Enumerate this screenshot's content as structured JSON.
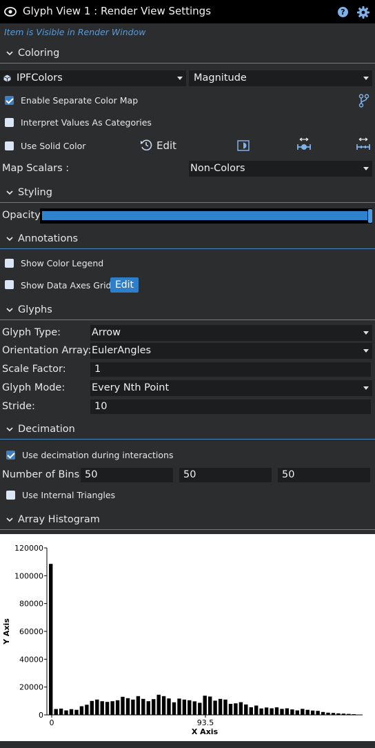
{
  "window": {
    "title": "Glyph View 1 : Render View Settings",
    "visibility_text": "Item is Visible in Render Window"
  },
  "coloring": {
    "section_label": "Coloring",
    "color_array": "IPFColors",
    "component": "Magnitude",
    "enable_separate_color_map": {
      "label": "Enable Separate Color Map",
      "checked": true
    },
    "interpret_as_categories": {
      "label": "Interpret Values As Categories",
      "checked": false
    },
    "use_solid_color": {
      "label": "Use Solid Color",
      "checked": false
    },
    "edit_label": "Edit",
    "map_scalars_label": "Map Scalars :",
    "map_scalars_value": "Non-Colors"
  },
  "styling": {
    "section_label": "Styling",
    "opacity_label": "Opacity",
    "opacity_value": 1.0
  },
  "annotations": {
    "section_label": "Annotations",
    "show_color_legend": {
      "label": "Show Color Legend",
      "checked": false
    },
    "show_data_axes_grid": {
      "label": "Show Data Axes Grid",
      "checked": false
    },
    "edit_label": "Edit"
  },
  "glyphs": {
    "section_label": "Glyphs",
    "glyph_type_label": "Glyph Type:",
    "glyph_type_value": "Arrow",
    "orientation_label": "Orientation Array:",
    "orientation_value": "EulerAngles",
    "scale_factor_label": "Scale Factor:",
    "scale_factor_value": "1",
    "glyph_mode_label": "Glyph Mode:",
    "glyph_mode_value": "Every Nth Point",
    "stride_label": "Stride:",
    "stride_value": "10"
  },
  "decimation": {
    "section_label": "Decimation",
    "use_decimation": {
      "label": "Use decimation during interactions",
      "checked": true
    },
    "bins_label": "Number of Bins :",
    "bins": [
      "50",
      "50",
      "50"
    ],
    "use_internal_triangles": {
      "label": "Use Internal Triangles",
      "checked": false
    }
  },
  "histogram": {
    "section_label": "Array Histogram"
  },
  "colors": {
    "accent": "#2e7fcb",
    "rule": "#4b86c1",
    "panel": "#2b2d2f",
    "field": "#1c1d1e"
  },
  "chart_data": {
    "type": "bar",
    "xlabel": "X Axis",
    "ylabel": "Y Axis",
    "ylim": [
      0,
      120000
    ],
    "yticks": [
      "0",
      "20000",
      "40000",
      "60000",
      "80000",
      "100000",
      "120000"
    ],
    "xticks": [
      "0",
      "93.5"
    ],
    "xlim": [
      0,
      187
    ],
    "values": [
      108500,
      4200,
      4500,
      3200,
      4100,
      3600,
      6200,
      7300,
      10000,
      11000,
      9800,
      9300,
      9800,
      10500,
      13000,
      12000,
      11000,
      13500,
      11500,
      9800,
      11300,
      14500,
      13500,
      11800,
      9000,
      11700,
      11000,
      10500,
      9700,
      8700,
      13800,
      13200,
      10200,
      11500,
      11000,
      7900,
      8300,
      9100,
      7500,
      5500,
      6700,
      4600,
      5300,
      4700,
      5400,
      4300,
      4700,
      3900,
      3200,
      4300,
      3600,
      3100,
      2900,
      2100,
      1600,
      1400,
      1100,
      900,
      700,
      500
    ],
    "grid": false,
    "legend": "none"
  }
}
